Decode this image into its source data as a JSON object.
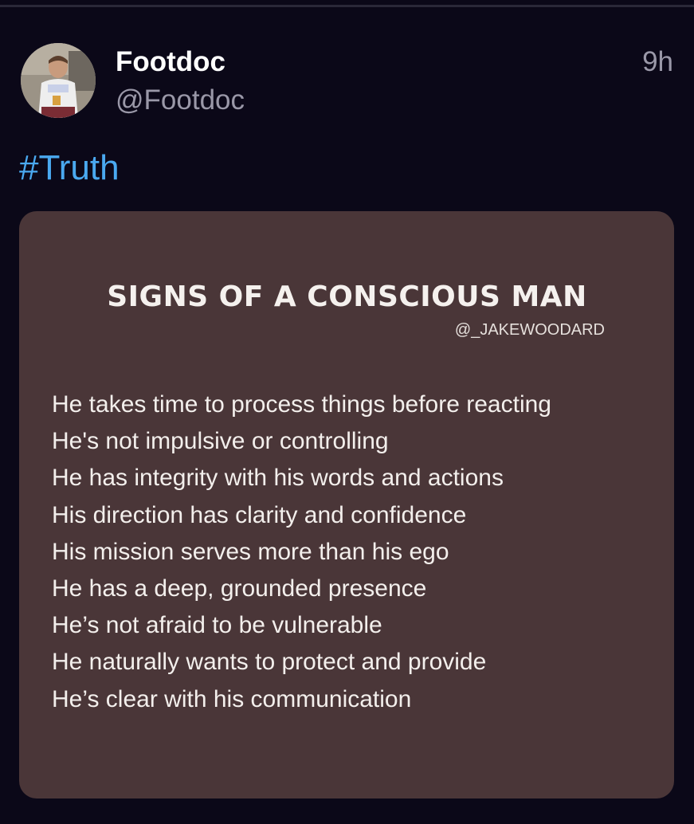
{
  "post": {
    "author": {
      "display_name": "Footdoc",
      "handle": "@Footdoc",
      "avatar": "avatar"
    },
    "timestamp": "9h",
    "text": "#Truth",
    "image": {
      "title": "SIGNS OF A CONSCIOUS MAN",
      "credit": "@_JAKEWOODARD",
      "lines": [
        "He takes time to process things before reacting",
        "He's not impulsive or controlling",
        "He has integrity with his words and actions",
        "His direction has clarity and confidence",
        "His mission serves more than his ego",
        "He has a deep, grounded presence",
        "He’s not afraid to be vulnerable",
        "He naturally wants to protect and provide",
        "He’s clear with his communication"
      ]
    }
  },
  "colors": {
    "background": "#0b0818",
    "hashtag": "#4aa9f0",
    "muted": "#9a98a8",
    "card": "#4a3638"
  }
}
